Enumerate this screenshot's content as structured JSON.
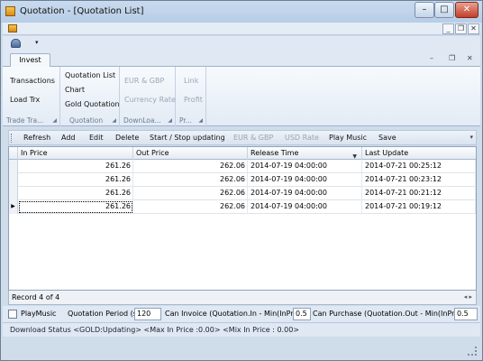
{
  "window": {
    "title": "Quotation - [Quotation List]",
    "min": "–",
    "max": "□",
    "close": "✕"
  },
  "mdi": {
    "min": "_",
    "restore": "❐",
    "close": "✕"
  },
  "qat": {
    "dropdown": "▾"
  },
  "ribbon": {
    "tab": "Invest",
    "controls": {
      "min": "–",
      "restore": "❐",
      "close": "✕"
    },
    "groups": [
      {
        "label": "Trade Tra...",
        "buttons": [
          "Transactions",
          "Load Trx"
        ]
      },
      {
        "label": "Quotation",
        "buttons": [
          "Quotation List",
          "Chart",
          "Gold Quotation"
        ]
      },
      {
        "label": "DownLoa...",
        "buttons": [
          "EUR & GBP",
          "Currency Rate"
        ]
      },
      {
        "label": "Pr...",
        "buttons": [
          "Link",
          "Profit"
        ]
      }
    ]
  },
  "toolbar": {
    "refresh": "Refresh",
    "add": "Add",
    "edit": "Edit",
    "delete": "Delete",
    "start_stop": "Start / Stop updating",
    "eur_gbp": "EUR & GBP",
    "usd_rate": "USD Rate",
    "play_music": "Play Music",
    "save": "Save",
    "overflow": "▾"
  },
  "grid": {
    "columns": [
      "In Price",
      "Out Price",
      "Release Time",
      "Last Update"
    ],
    "sort_indicator": "▼",
    "current_row_marker": "▶",
    "rows": [
      {
        "in": "261.26",
        "out": "262.06",
        "release": "2014-07-19 04:00:00",
        "update": "2014-07-21 00:25:12"
      },
      {
        "in": "261.26",
        "out": "262.06",
        "release": "2014-07-19 04:00:00",
        "update": "2014-07-21 00:23:12"
      },
      {
        "in": "261.26",
        "out": "262.06",
        "release": "2014-07-19 04:00:00",
        "update": "2014-07-21 00:21:12"
      },
      {
        "in": "261.26",
        "out": "262.06",
        "release": "2014-07-19 04:00:00",
        "update": "2014-07-21 00:19:12"
      }
    ]
  },
  "record_bar": {
    "text": "Record 4 of 4",
    "left": "◂",
    "right": "▸"
  },
  "settings": {
    "play_music_label": "PlayMusic",
    "period_label": "Quotation Period (s)",
    "period_value": "120",
    "invoice_label": "Can Invoice (Quotation.In - Min(InPrice))",
    "invoice_value": "0.5",
    "purchase_label": "Can Purchase (Quotation.Out - Min(InPrice))",
    "purchase_value": "0.5"
  },
  "status": {
    "text": "Download Status <GOLD:Updating>   <Max In Price :0.00>  <Mix In Price : 0.00>"
  }
}
